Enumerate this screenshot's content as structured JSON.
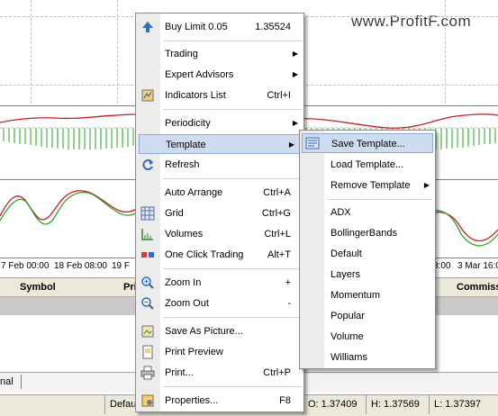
{
  "watermark": "www.ProfitF.com",
  "time_axis": [
    "7 Feb 00:00",
    "18 Feb 08:00",
    "19 F",
    "3:00",
    "3 Mar 16:0"
  ],
  "terminal": {
    "columns": [
      "Symbol",
      "Pri",
      "Commiss"
    ],
    "tab_label": "nal"
  },
  "statusbar": {
    "default": "Defau",
    "open": "O: 1.37409",
    "high": "H: 1.37569",
    "low": "L: 1.37397"
  },
  "context_menu": {
    "items": [
      {
        "label": "Buy Limit 0.05",
        "shortcut": "1.35524",
        "icon": "buy-limit-icon"
      },
      {
        "label": "Trading",
        "submenu": true
      },
      {
        "label": "Expert Advisors",
        "submenu": true
      },
      {
        "label": "Indicators List",
        "shortcut": "Ctrl+I",
        "icon": "indicators-list-icon"
      },
      {
        "label": "Periodicity",
        "submenu": true
      },
      {
        "label": "Template",
        "submenu": true,
        "highlighted": true
      },
      {
        "label": "Refresh",
        "icon": "refresh-icon"
      },
      {
        "label": "Auto Arrange",
        "shortcut": "Ctrl+A"
      },
      {
        "label": "Grid",
        "shortcut": "Ctrl+G",
        "icon": "grid-icon"
      },
      {
        "label": "Volumes",
        "shortcut": "Ctrl+L",
        "icon": "volumes-icon"
      },
      {
        "label": "One Click Trading",
        "shortcut": "Alt+T",
        "icon": "one-click-trading-icon"
      },
      {
        "label": "Zoom In",
        "shortcut": "+",
        "icon": "zoom-in-icon"
      },
      {
        "label": "Zoom Out",
        "shortcut": "-",
        "icon": "zoom-out-icon"
      },
      {
        "label": "Save As Picture...",
        "icon": "save-picture-icon"
      },
      {
        "label": "Print Preview",
        "icon": "print-preview-icon"
      },
      {
        "label": "Print...",
        "shortcut": "Ctrl+P",
        "icon": "print-icon"
      },
      {
        "label": "Properties...",
        "shortcut": "F8",
        "icon": "properties-icon"
      }
    ]
  },
  "template_submenu": {
    "items": [
      {
        "label": "Save Template...",
        "highlighted": true,
        "icon": "save-template-icon"
      },
      {
        "label": "Load Template..."
      },
      {
        "label": "Remove Template",
        "submenu": true
      },
      {
        "label": "ADX"
      },
      {
        "label": "BollingerBands"
      },
      {
        "label": "Default"
      },
      {
        "label": "Layers"
      },
      {
        "label": "Momentum"
      },
      {
        "label": "Popular"
      },
      {
        "label": "Volume"
      },
      {
        "label": "Williams"
      }
    ]
  },
  "colors": {
    "histogram": "#2aa52a",
    "main_line": "#c81e1e",
    "signal_line": "#2aa52a",
    "highlight": "#cfdcef"
  }
}
